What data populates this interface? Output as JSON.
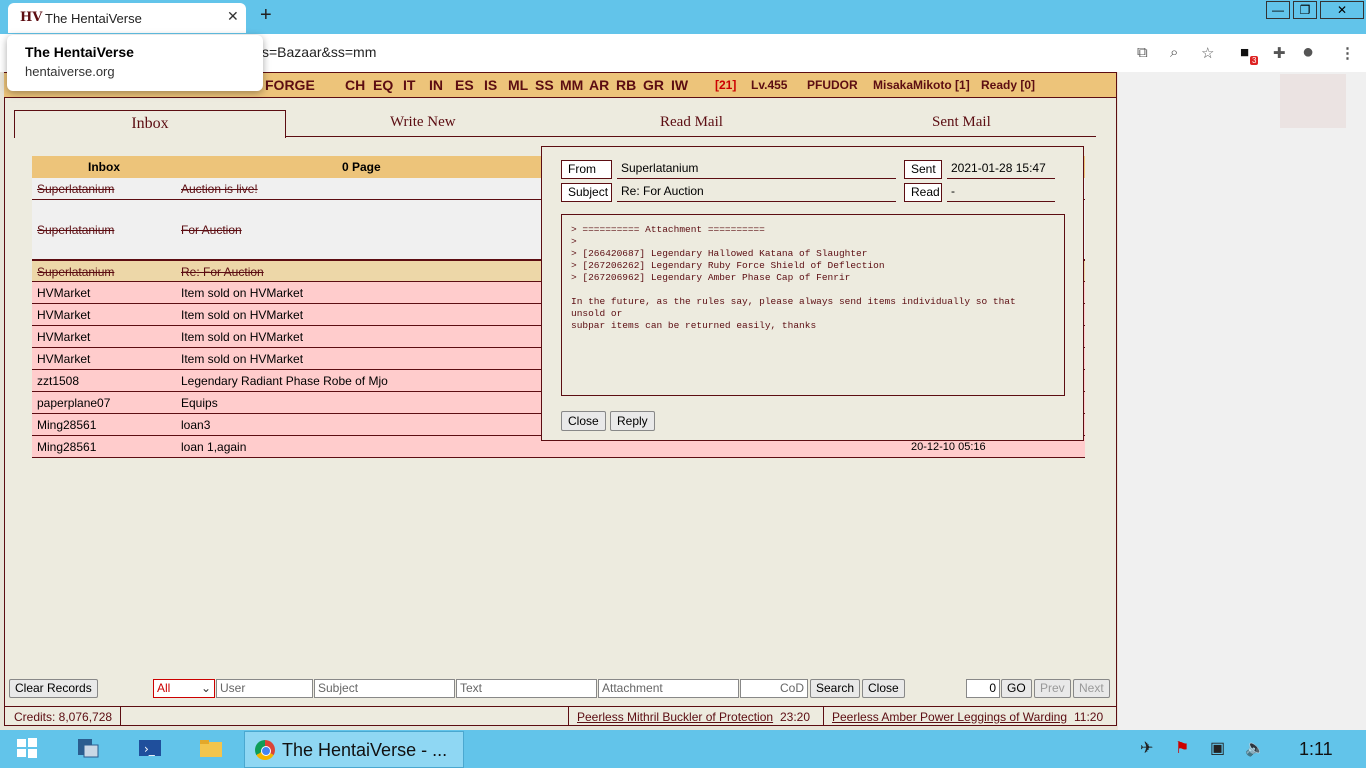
{
  "browser": {
    "tab_title": "The HentaiVerse",
    "favicon": "HV",
    "url_visible": "s=Bazaar&ss=mm",
    "popup_title": "The HentaiVerse",
    "popup_domain": "hentaiverse.org",
    "extension_badge": "3"
  },
  "menubar": {
    "forge": "FORGE",
    "items": [
      "CH",
      "EQ",
      "IT",
      "IN",
      "ES",
      "IS",
      "ML",
      "SS",
      "MM",
      "AR",
      "RB",
      "GR",
      "IW"
    ],
    "counter": "[21]",
    "level": "Lv.455",
    "difficulty": "PFUDOR",
    "player": "MisakaMikoto [1]",
    "ready": "Ready [0]"
  },
  "mail_tabs": [
    "Inbox",
    "Write New",
    "Read Mail",
    "Sent Mail"
  ],
  "inbox": {
    "header_from": "Inbox",
    "header_subject": "0 Page",
    "rows": [
      {
        "from": "Superlatanium",
        "subject": "Auction is live!",
        "date": "",
        "read": true
      },
      {
        "from": "Superlatanium",
        "subject": "For Auction",
        "date": "",
        "read": true
      },
      {
        "from": "Superlatanium",
        "subject": "Re: For Auction",
        "date": "",
        "read": true
      },
      {
        "from": "HVMarket",
        "subject": "Item sold on HVMarket",
        "date": "",
        "read": false
      },
      {
        "from": "HVMarket",
        "subject": "Item sold on HVMarket",
        "date": "",
        "read": false
      },
      {
        "from": "HVMarket",
        "subject": "Item sold on HVMarket",
        "date": "",
        "read": false
      },
      {
        "from": "HVMarket",
        "subject": "Item sold on HVMarket",
        "date": "",
        "read": false
      },
      {
        "from": "zzt1508",
        "subject": "Legendary Radiant Phase Robe of Mjo",
        "date": "",
        "read": false
      },
      {
        "from": "paperplane07",
        "subject": "Equips",
        "date": "",
        "read": false
      },
      {
        "from": "Ming28561",
        "subject": "loan3",
        "date": "",
        "read": false
      },
      {
        "from": "Ming28561",
        "subject": "loan 1,again",
        "date": "20-12-10 05:16",
        "read": false
      }
    ]
  },
  "mail_view": {
    "from_label": "From",
    "from_value": "Superlatanium",
    "subject_label": "Subject",
    "subject_value": "Re: For Auction",
    "sent_label": "Sent",
    "sent_value": "2021-01-28 15:47",
    "read_label": "Read",
    "read_value": "-",
    "body": "> ========== Attachment ==========\n>\n> [266420687] Legendary Hallowed Katana of Slaughter\n> [267206262] Legendary Ruby Force Shield of Deflection\n> [267206962] Legendary Amber Phase Cap of Fenrir\n\nIn the future, as the rules say, please always send items individually so that unsold or\nsubpar items can be returned easily, thanks",
    "close_label": "Close",
    "reply_label": "Reply"
  },
  "search_bar": {
    "clear_label": "Clear Records",
    "filter_selected": "All",
    "user_placeholder": "User",
    "subject_placeholder": "Subject",
    "text_placeholder": "Text",
    "attachment_placeholder": "Attachment",
    "cod_placeholder": "CoD",
    "search_label": "Search",
    "close_label": "Close",
    "page_value": "0",
    "go_label": "GO",
    "prev_label": "Prev",
    "next_label": "Next"
  },
  "status": {
    "credits": "Credits: 8,076,728",
    "item1": "Peerless Mithril Buckler of Protection",
    "time1": "23:20",
    "item2": "Peerless Amber Power Leggings of Warding",
    "time2": "11:20"
  },
  "taskbar": {
    "chrome_label": "The HentaiVerse - ...",
    "clock": "1:11"
  },
  "colors": {
    "accent": "#5c0d12",
    "menubar": "#edc47a",
    "unread_row": "#ffcccc",
    "read_row": "#f0f0f0",
    "highlight_row": "#edd7a8",
    "chrome_blue": "#62c4ea"
  }
}
